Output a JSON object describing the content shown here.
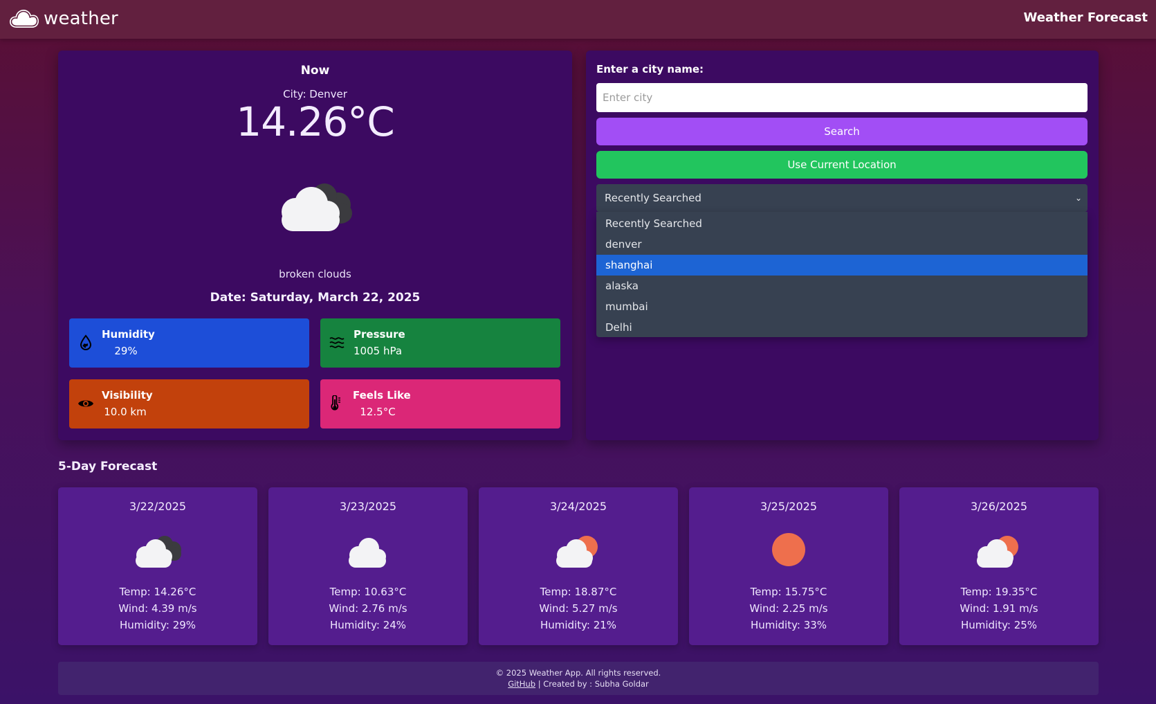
{
  "header": {
    "brand": "weather",
    "brand_icon": "cloud-icon",
    "title": "Weather Forecast"
  },
  "current": {
    "heading": "Now",
    "city_label": "City:",
    "city": "Denver",
    "temperature": "14.26°C",
    "icon": "broken-clouds-icon",
    "description": "broken clouds",
    "date_label": "Date:",
    "date": "Saturday, March 22, 2025",
    "stats": {
      "humidity": {
        "label": "Humidity",
        "value": "29%",
        "icon": "droplet-icon",
        "color": "#1d4ed8"
      },
      "pressure": {
        "label": "Pressure",
        "value": "1005 hPa",
        "icon": "waves-icon",
        "color": "#16833f"
      },
      "visibility": {
        "label": "Visibility",
        "value": "10.0 km",
        "icon": "eye-icon",
        "color": "#c2410c"
      },
      "feels_like": {
        "label": "Feels Like",
        "value": "12.5°C",
        "icon": "thermometer-icon",
        "color": "#db2777"
      }
    }
  },
  "search": {
    "label": "Enter a city name:",
    "placeholder": "Enter city",
    "value": "",
    "search_button": "Search",
    "location_button": "Use Current Location",
    "recent_select": {
      "selected": "Recently Searched",
      "options": [
        "Recently Searched",
        "denver",
        "shanghai",
        "alaska",
        "mumbai",
        "Delhi"
      ],
      "highlighted": "shanghai"
    }
  },
  "forecast": {
    "title": "5-Day Forecast",
    "temp_label": "Temp:",
    "wind_label": "Wind:",
    "humidity_label": "Humidity:",
    "days": [
      {
        "date": "3/22/2025",
        "icon": "broken-clouds-icon",
        "temp": "14.26°C",
        "wind": "4.39 m/s",
        "humidity": "29%"
      },
      {
        "date": "3/23/2025",
        "icon": "cloud-icon",
        "temp": "10.63°C",
        "wind": "2.76 m/s",
        "humidity": "24%"
      },
      {
        "date": "3/24/2025",
        "icon": "partly-cloudy-icon",
        "temp": "18.87°C",
        "wind": "5.27 m/s",
        "humidity": "21%"
      },
      {
        "date": "3/25/2025",
        "icon": "sun-icon",
        "temp": "15.75°C",
        "wind": "2.25 m/s",
        "humidity": "33%"
      },
      {
        "date": "3/26/2025",
        "icon": "partly-cloudy-icon",
        "temp": "19.35°C",
        "wind": "1.91 m/s",
        "humidity": "25%"
      }
    ]
  },
  "footer": {
    "copyright": "© 2025 Weather App. All rights reserved.",
    "github_link": "GitHub",
    "separator": "|",
    "credit": "Created by : Subha Goldar"
  },
  "colors": {
    "accent_purple": "#a24ef5",
    "accent_green": "#22c55e",
    "panel": "#3c0a61",
    "card": "#541d8e",
    "highlight": "#1d64d4"
  }
}
